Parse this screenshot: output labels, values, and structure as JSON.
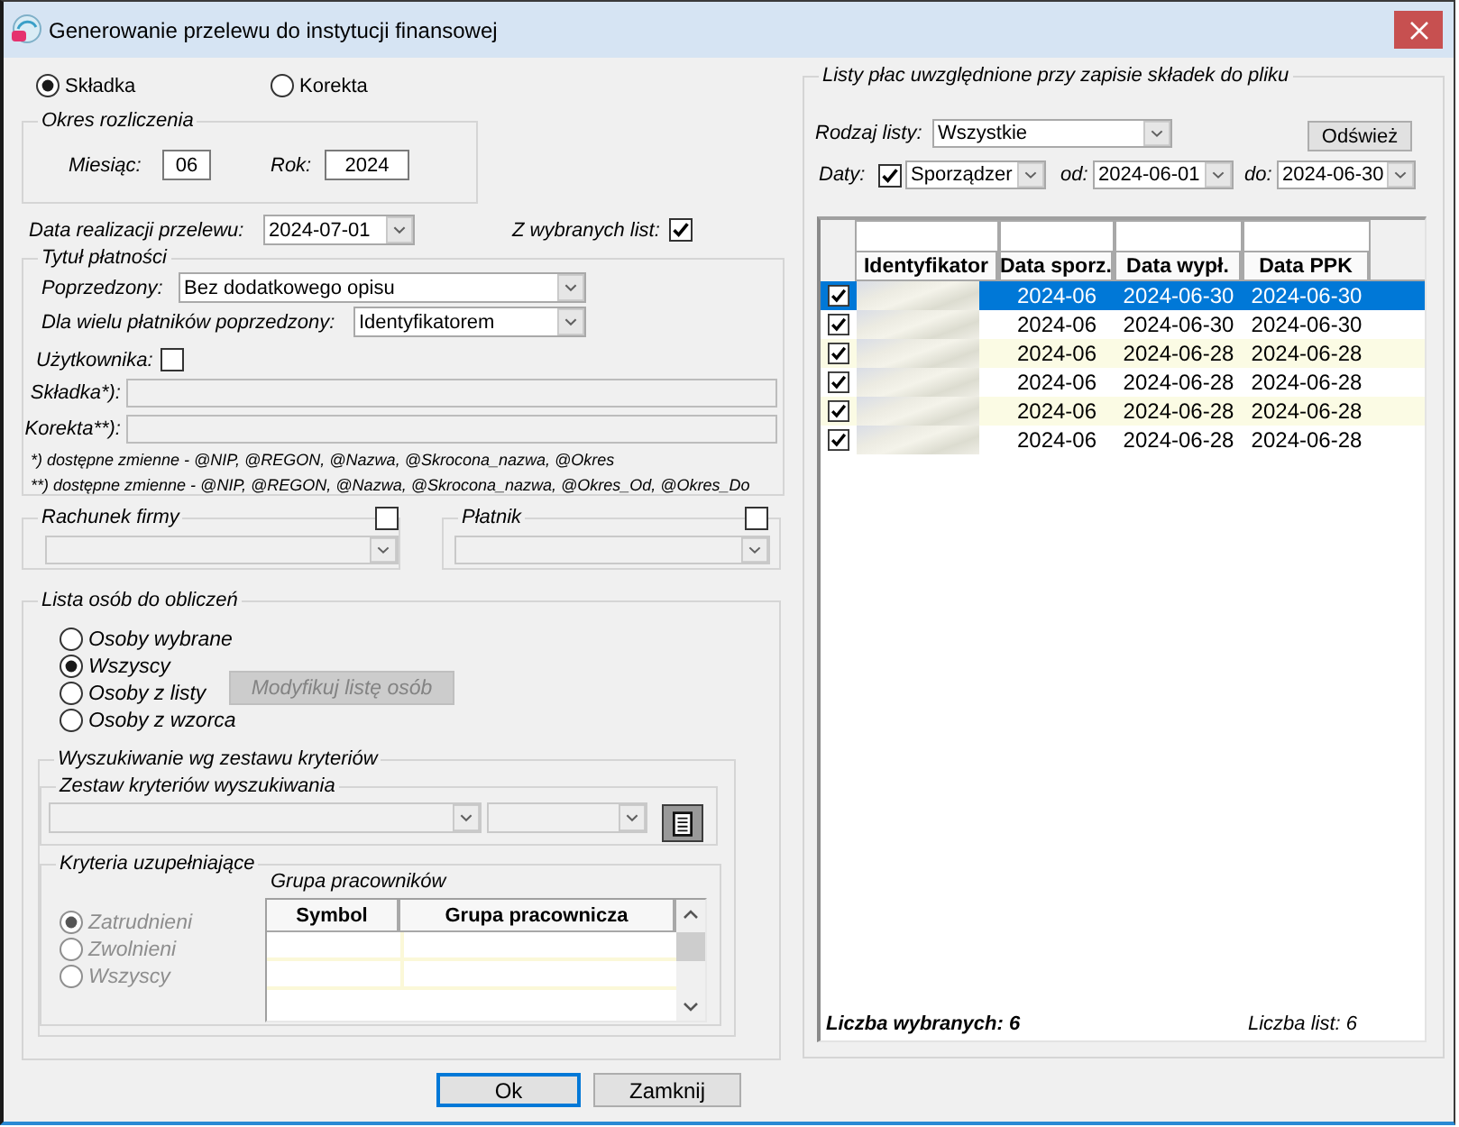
{
  "window": {
    "title": "Generowanie przelewu do instytucji finansowej"
  },
  "mode": [
    {
      "label": "Składka",
      "selected": true
    },
    {
      "label": "Korekta",
      "selected": false
    }
  ],
  "settlement_period": {
    "legend": "Okres rozliczenia",
    "month_label": "Miesiąc:",
    "month": "06",
    "year_label": "Rok:",
    "year": "2024"
  },
  "transfer_date": {
    "label": "Data realizacji przelewu:",
    "value": "2024-07-01"
  },
  "selected_lists": {
    "label": "Z wybranych list:",
    "checked": true
  },
  "payment_title": {
    "legend": "Tytuł płatności",
    "prefix_label": "Poprzedzony:",
    "prefix_value": "Bez dodatkowego opisu",
    "multi_payer_label": "Dla wielu płatników poprzedzony:",
    "multi_payer_value": "Identyfikatorem",
    "user_label": "Użytkownika:",
    "user_checked": false,
    "fields": [
      {
        "label": "Składka*):",
        "disabled": true
      },
      {
        "label": "Korekta**):",
        "disabled": true
      }
    ],
    "notes": [
      "*) dostępne zmienne - @NIP, @REGON, @Nazwa, @Skrocona_nazwa, @Okres",
      "**) dostępne zmienne - @NIP, @REGON, @Nazwa, @Skrocona_nazwa, @Okres_Od, @Okres_Do"
    ]
  },
  "company_account": {
    "legend": "Rachunek firmy",
    "checked": false,
    "disabled": true
  },
  "payer": {
    "legend": "Płatnik",
    "checked": false,
    "disabled": true
  },
  "person_list": {
    "legend": "Lista osób do obliczeń",
    "options": [
      {
        "label": "Osoby wybrane",
        "selected": false
      },
      {
        "label": "Wszyscy",
        "selected": true
      },
      {
        "label": "Osoby z listy",
        "selected": false
      },
      {
        "label": "Osoby z wzorca",
        "selected": false
      }
    ],
    "modify_button": {
      "label": "Modyfikuj listę osób",
      "disabled": true
    },
    "criteria_search": {
      "legend": "Wyszukiwanie wg zestawu kryteriów",
      "set_legend": "Zestaw kryteriów wyszukiwania",
      "set_disabled": true,
      "supplementary_legend": "Kryteria uzupełniające",
      "supplementary_disabled": true,
      "options": [
        {
          "label": "Zatrudnieni",
          "selected": true
        },
        {
          "label": "Zwolnieni",
          "selected": false
        },
        {
          "label": "Wszyscy",
          "selected": false
        }
      ],
      "group_label": "Grupa pracowników",
      "group_columns": [
        "Symbol",
        "Grupa pracownicza"
      ]
    }
  },
  "payroll_lists": {
    "legend": "Listy płac uwzględnione przy zapisie składek do pliku",
    "type_label": "Rodzaj listy:",
    "type_value": "Wszystkie",
    "refresh_button": "Odśwież",
    "dates_label": "Daty:",
    "dates_checked": true,
    "date_kind": "Sporządzer",
    "from_label": "od:",
    "from": "2024-06-01",
    "to_label": "do:",
    "to": "2024-06-30",
    "columns": [
      "Identyfikator",
      "Data sporz.",
      "Data wypł.",
      "Data PPK"
    ],
    "rows": [
      {
        "checked": true,
        "selected": true,
        "cells": [
          "",
          "2024-06",
          "2024-06-30",
          "2024-06-30"
        ]
      },
      {
        "checked": true,
        "selected": false,
        "cells": [
          "",
          "2024-06",
          "2024-06-30",
          "2024-06-30"
        ]
      },
      {
        "checked": true,
        "selected": false,
        "cells": [
          "",
          "2024-06",
          "2024-06-28",
          "2024-06-28"
        ]
      },
      {
        "checked": true,
        "selected": false,
        "cells": [
          "",
          "2024-06",
          "2024-06-28",
          "2024-06-28"
        ]
      },
      {
        "checked": true,
        "selected": false,
        "cells": [
          "",
          "2024-06",
          "2024-06-28",
          "2024-06-28"
        ]
      },
      {
        "checked": true,
        "selected": false,
        "cells": [
          "",
          "2024-06",
          "2024-06-28",
          "2024-06-28"
        ]
      }
    ],
    "selected_count": "Liczba wybranych: 6",
    "list_count": "Liczba list: 6"
  },
  "buttons": [
    {
      "label": "Ok",
      "focused": true
    },
    {
      "label": "Zamknij",
      "focused": false
    }
  ]
}
